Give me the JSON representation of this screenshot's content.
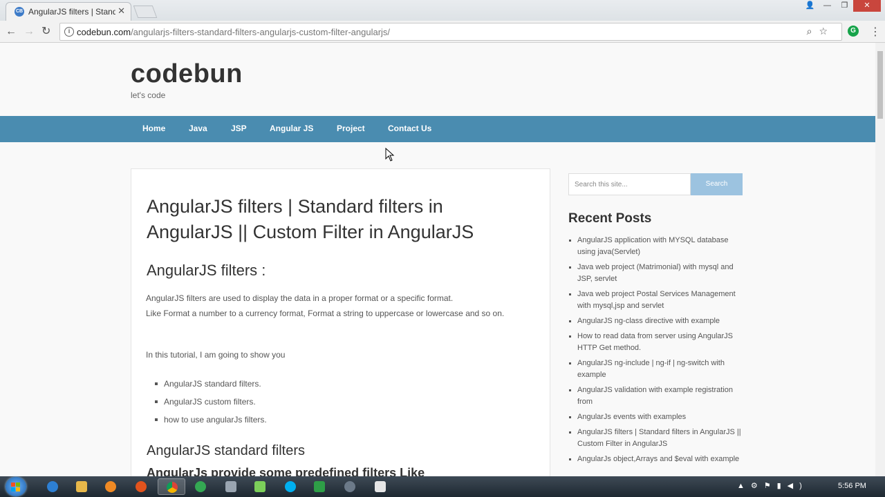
{
  "browser": {
    "tab_title": "AngularJS filters | Standa",
    "tab_favicon_text": "CB",
    "close_glyph": "✕",
    "url_host": "codebun.com",
    "url_path": "/angularjs-filters-standard-filters-angularjs-custom-filter-angularjs/",
    "extension_letter": "G",
    "icons": [
      "back-icon",
      "forward-icon",
      "reload-icon",
      "info-icon",
      "zoom-icon",
      "bookmark-star-icon",
      "grammarly-icon",
      "menu-icon"
    ]
  },
  "site": {
    "brand": "codebun",
    "tagline": "let's code",
    "nav": [
      "Home",
      "Java",
      "JSP",
      "Angular JS",
      "Project",
      "Contact Us"
    ],
    "accent_color": "#4a8cb0"
  },
  "article": {
    "title": "AngularJS filters | Standard filters in AngularJS || Custom Filter in AngularJS",
    "section1_heading": "AngularJS filters :",
    "intro_line1": "AngularJS filters are used to display the data in a proper format or a specific format.",
    "intro_line2": "Like Format a number to a currency format, Format a string to uppercase or lowercase and so on.",
    "tutorial_intro": "In this tutorial, I am going to show you",
    "bullets": [
      "AngularJS standard filters.",
      "AngularJS custom filters.",
      "how to use angularJs filters."
    ],
    "section2_heading": "AngularJS standard filters",
    "section3_partial": "AngularJs provide some predefined filters Like"
  },
  "sidebar": {
    "search_placeholder": "Search this site...",
    "search_button": "Search",
    "recent_heading": "Recent Posts",
    "recent_posts": [
      "AngularJS application with MYSQL database using java(Servlet)",
      "Java web project (Matrimonial) with mysql and JSP, servlet",
      "Java web project Postal Services Management with mysql,jsp and servlet",
      "AngularJS ng-class directive with example",
      "How to read data from server using AngularJS HTTP Get method.",
      "AngularJS ng-include | ng-if | ng-switch with example",
      "AngularJS validation with example registration from",
      "AngularJs events with examples",
      "AngularJS filters | Standard filters in AngularJS || Custom Filter in AngularJS",
      "AngularJs object,Arrays and $eval with example"
    ]
  },
  "taskbar": {
    "clock": "5:56 PM",
    "apps": [
      "ie-icon",
      "explorer-icon",
      "media-player-icon",
      "firefox-icon",
      "chrome-icon",
      "messenger-icon",
      "file-manager-icon",
      "notes-icon",
      "skype-icon",
      "camtasia-icon",
      "settings-icon",
      "terminal-icon"
    ]
  }
}
